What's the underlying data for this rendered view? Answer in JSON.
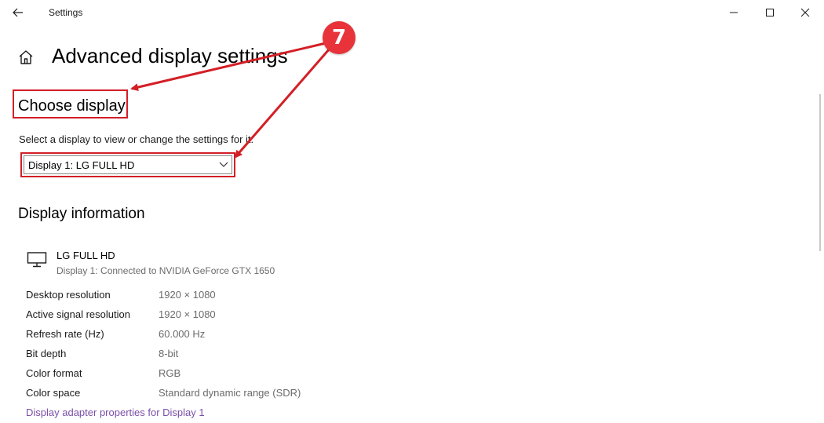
{
  "window": {
    "title": "Settings"
  },
  "page": {
    "title": "Advanced display settings"
  },
  "choose_display": {
    "heading": "Choose display",
    "description": "Select a display to view or change the settings for it.",
    "dropdown_value": "Display 1: LG FULL HD"
  },
  "display_info": {
    "heading": "Display information",
    "monitor_name": "LG FULL HD",
    "monitor_connection": "Display 1: Connected to NVIDIA GeForce GTX 1650",
    "rows": [
      {
        "label": "Desktop resolution",
        "value": "1920 × 1080"
      },
      {
        "label": "Active signal resolution",
        "value": "1920 × 1080"
      },
      {
        "label": "Refresh rate (Hz)",
        "value": "60.000 Hz"
      },
      {
        "label": "Bit depth",
        "value": "8-bit"
      },
      {
        "label": "Color format",
        "value": "RGB"
      },
      {
        "label": "Color space",
        "value": "Standard dynamic range (SDR)"
      }
    ],
    "adapter_link": "Display adapter properties for Display 1"
  },
  "annotation": {
    "step_number": "7",
    "color": "#e8333a"
  },
  "icons": {
    "back": "back-arrow-icon",
    "home": "home-icon",
    "minimize": "minimize-icon",
    "maximize": "maximize-icon",
    "close": "close-icon",
    "dropdown": "chevron-down-icon",
    "monitor": "monitor-icon"
  },
  "colors": {
    "highlight_border": "#d31f26",
    "link": "#7a4fa8",
    "secondary_text": "#6b6b6b"
  }
}
